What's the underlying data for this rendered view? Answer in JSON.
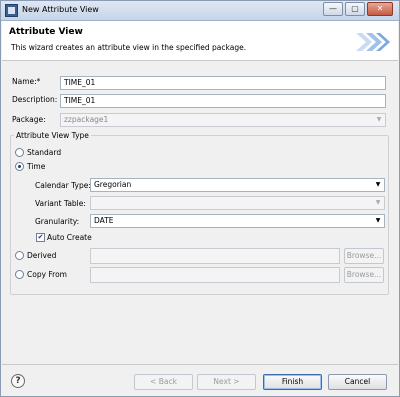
{
  "window": {
    "title": "New Attribute View",
    "controls": {
      "minimize": "—",
      "maximize": "▢",
      "close": "✕"
    }
  },
  "banner": {
    "title": "Attribute View",
    "description": "This wizard creates an attribute view in the specified package."
  },
  "form": {
    "name": {
      "label": "Name:*",
      "value": "TIME_01"
    },
    "description": {
      "label": "Description:",
      "value": "TIME_01"
    },
    "package": {
      "label": "Package:",
      "value": "zzpackage1"
    }
  },
  "type_group": {
    "title": "Attribute View Type",
    "options": {
      "standard": {
        "label": "Standard",
        "selected": false
      },
      "time": {
        "label": "Time",
        "selected": true
      },
      "derived": {
        "label": "Derived",
        "selected": false
      },
      "copy_from": {
        "label": "Copy From",
        "selected": false
      }
    },
    "time_settings": {
      "calendar_type": {
        "label": "Calendar Type:",
        "value": "Gregorian"
      },
      "variant_table": {
        "label": "Variant Table:",
        "value": ""
      },
      "granularity": {
        "label": "Granularity:",
        "value": "DATE"
      },
      "auto_create": {
        "label": "Auto Create",
        "checked": true
      }
    },
    "browse_label": "Browse..."
  },
  "footer": {
    "help_icon": "?",
    "back": "< Back",
    "next": "Next >",
    "finish": "Finish",
    "cancel": "Cancel"
  },
  "icons": {
    "combo_arrow": "▼",
    "checkmark": "✔"
  }
}
